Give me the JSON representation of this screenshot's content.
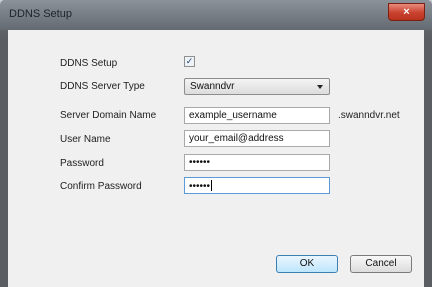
{
  "window": {
    "title": "DDNS Setup",
    "close_glyph": "×"
  },
  "form": {
    "ddns_setup": {
      "label": "DDNS Setup",
      "checked": true,
      "check_glyph": "✓"
    },
    "server_type": {
      "label": "DDNS Server Type",
      "value": "Swanndvr"
    },
    "domain": {
      "label": "Server Domain Name",
      "value": "example_username",
      "suffix": ".swanndvr.net"
    },
    "user": {
      "label": "User Name",
      "value": "your_email@address"
    },
    "password": {
      "label": "Password",
      "value": "••••••"
    },
    "confirm": {
      "label": "Confirm Password",
      "value": "••••••"
    }
  },
  "buttons": {
    "ok": "OK",
    "cancel": "Cancel"
  }
}
